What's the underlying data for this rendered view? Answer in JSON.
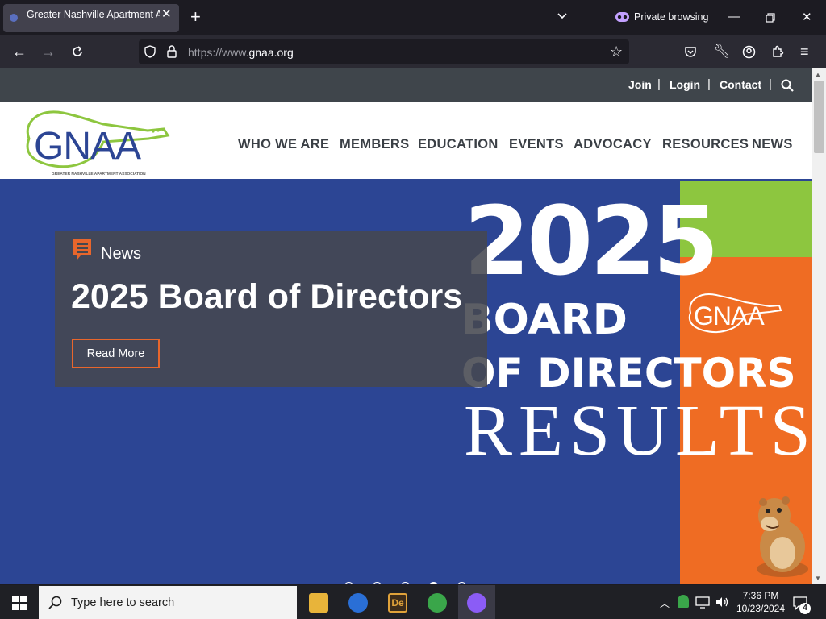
{
  "browser": {
    "tab_title": "Greater Nashville Apartment As",
    "private_label": "Private browsing",
    "url_prefix": "https://www.",
    "url_domain": "gnaa.org"
  },
  "site": {
    "utility_links": [
      "Join",
      "Login",
      "Contact"
    ],
    "logo_text": "GNAA",
    "logo_tagline": "GREATER NASHVILLE APARTMENT ASSOCIATION",
    "menu": [
      "WHO WE ARE",
      "MEMBERS",
      "EDUCATION",
      "EVENTS",
      "ADVOCACY",
      "RESOURCES",
      "NEWS"
    ],
    "hero": {
      "category": "News",
      "headline": "2025 Board of Directors",
      "button": "Read More",
      "graphic_year": "2025",
      "graphic_board": "BOARD",
      "graphic_of_directors": "OF DIRECTORS",
      "graphic_results": "RESULTS",
      "slide_count": 5,
      "active_slide": 4
    }
  },
  "taskbar": {
    "search_placeholder": "Type here to search",
    "time": "7:36 PM",
    "date": "10/23/2024",
    "notification_count": "4"
  },
  "colors": {
    "brand_blue": "#2c4594",
    "brand_green": "#8dc63f",
    "brand_orange": "#ef6c23"
  }
}
